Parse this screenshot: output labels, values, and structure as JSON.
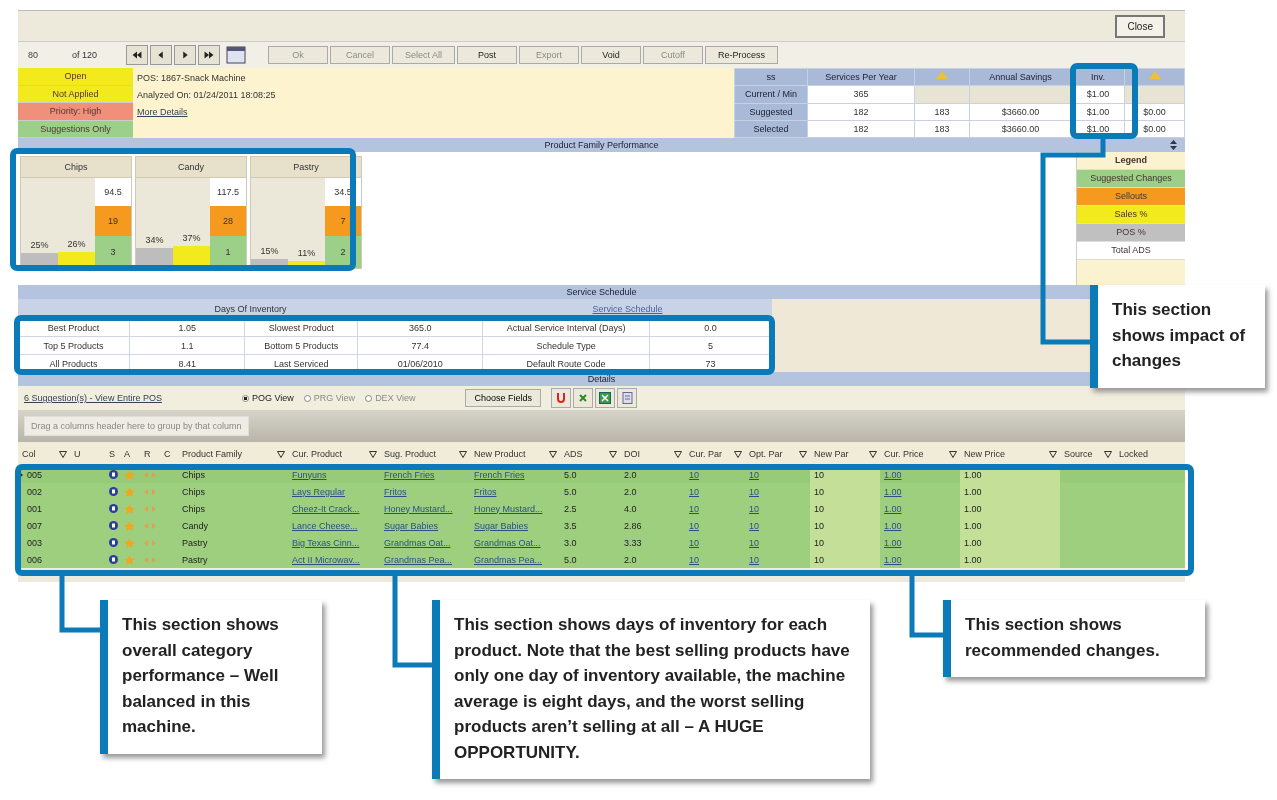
{
  "window": {
    "close_button": "Close"
  },
  "toolbar": {
    "record": "80",
    "record_count": "of 120",
    "buttons": [
      {
        "label": "Ok",
        "disabled": true
      },
      {
        "label": "Cancel",
        "disabled": true
      },
      {
        "label": "Select All",
        "disabled": true
      },
      {
        "label": "Post",
        "disabled": false
      },
      {
        "label": "Export",
        "disabled": true
      },
      {
        "label": "Void",
        "disabled": false
      },
      {
        "label": "Cutoff",
        "disabled": true
      },
      {
        "label": "Re-Process",
        "disabled": false
      }
    ]
  },
  "status_tags": [
    {
      "label": "Open",
      "color": "#f2ea1c"
    },
    {
      "label": "Not Applied",
      "color": "#f2ea1c"
    },
    {
      "label": "Priority: High",
      "color": "#f0907a"
    },
    {
      "label": "Suggestions Only",
      "color": "#9ccf88"
    }
  ],
  "info": {
    "pos": "POS: 1867-Snack Machine",
    "analyzed": "Analyzed On: 01/24/2011 18:08:25",
    "more_details": "More Details"
  },
  "summary": {
    "columns": [
      {
        "kind": "text",
        "label": "ss"
      },
      {
        "kind": "text",
        "label": "Services Per Year"
      },
      {
        "kind": "icon"
      },
      {
        "kind": "text",
        "label": "Annual Savings"
      },
      {
        "kind": "text",
        "label": "Inv."
      },
      {
        "kind": "icon"
      }
    ],
    "rows": [
      {
        "cells": [
          "Current / Min",
          "365",
          null,
          null,
          "$1.00",
          null
        ]
      },
      {
        "cells": [
          "Suggested",
          "182",
          "183",
          "$3660.00",
          "$1.00",
          "$0.00"
        ]
      },
      {
        "cells": [
          "Selected",
          "182",
          "183",
          "$3660.00",
          "$1.00",
          "$0.00"
        ]
      }
    ]
  },
  "performance": {
    "title": "Product Family Performance",
    "families": [
      {
        "name": "Chips",
        "pos_share": "25%",
        "sales_share": "26%",
        "total_ads": "94.5",
        "sellouts": "19",
        "suggested_changes": "3"
      },
      {
        "name": "Candy",
        "pos_share": "34%",
        "sales_share": "37%",
        "total_ads": "117.5",
        "sellouts": "28",
        "suggested_changes": "1"
      },
      {
        "name": "Pastry",
        "pos_share": "15%",
        "sales_share": "11%",
        "total_ads": "34.5",
        "sellouts": "7",
        "suggested_changes": "2"
      }
    ],
    "legend_title": "Legend",
    "legend": [
      {
        "label": "Suggested Changes",
        "color": "#9ccf88"
      },
      {
        "label": "Sellouts",
        "color": "#f59a1e"
      },
      {
        "label": "Sales %",
        "color": "#f2ea1c"
      },
      {
        "label": "POS %",
        "color": "#c0c0c0"
      },
      {
        "label": "Total ADS",
        "color": "#ffffff"
      }
    ]
  },
  "schedule": {
    "title": "Service Schedule",
    "groups": [
      "Days Of Inventory",
      "Service Schedule"
    ],
    "rows": [
      [
        "Best Product",
        "1.05",
        "Slowest Product",
        "365.0",
        "Actual Service Interval (Days)",
        "0.0"
      ],
      [
        "Top 5 Products",
        "1.1",
        "Bottom 5 Products",
        "77.4",
        "Schedule Type",
        "5"
      ],
      [
        "All Products",
        "8.41",
        "Last Serviced",
        "01/06/2010",
        "Default Route Code",
        "73"
      ]
    ]
  },
  "details": {
    "title": "Details",
    "link": "6 Suggestion(s) - View Entire POS",
    "views": [
      {
        "label": "POG View",
        "selected": true,
        "disabled": false
      },
      {
        "label": "PRG View",
        "selected": false,
        "disabled": true
      },
      {
        "label": "DEX View",
        "selected": false,
        "disabled": true
      }
    ],
    "choose_fields": "Choose Fields",
    "group_hint": "Drag a columns header here to group by that column",
    "columns": [
      {
        "label": "Col",
        "kind": "text",
        "filter": true
      },
      {
        "label": "U",
        "kind": "empty",
        "filter": false
      },
      {
        "label": "S",
        "kind": "status",
        "filter": false
      },
      {
        "label": "A",
        "kind": "action",
        "filter": false
      },
      {
        "label": "R",
        "kind": "reason",
        "filter": false
      },
      {
        "label": "C",
        "kind": "empty",
        "filter": false
      },
      {
        "label": "Product Family",
        "kind": "text",
        "filter": true
      },
      {
        "label": "Cur. Product",
        "kind": "link",
        "filter": true
      },
      {
        "label": "Sug. Product",
        "kind": "link",
        "filter": true
      },
      {
        "label": "New Product",
        "kind": "link",
        "filter": true
      },
      {
        "label": "ADS",
        "kind": "text",
        "filter": true
      },
      {
        "label": "DOI",
        "kind": "text",
        "filter": true
      },
      {
        "label": "Cur. Par",
        "kind": "link",
        "filter": true
      },
      {
        "label": "Opt. Par",
        "kind": "link",
        "filter": true
      },
      {
        "label": "New Par",
        "kind": "edit",
        "filter": true
      },
      {
        "label": "Cur. Price",
        "kind": "link",
        "filter": true
      },
      {
        "label": "New Price",
        "kind": "edit",
        "filter": true
      },
      {
        "label": "Source",
        "kind": "empty",
        "filter": true
      },
      {
        "label": "Locked",
        "kind": "empty",
        "filter": false
      }
    ],
    "rows": [
      {
        "current": true,
        "cells": [
          "005",
          null,
          null,
          null,
          null,
          null,
          "Chips",
          "Funyuns",
          "French Fries",
          "French Fries",
          "5.0",
          "2.0",
          "10",
          "10",
          "10",
          "1.00",
          "1.00",
          null,
          null
        ]
      },
      {
        "current": false,
        "cells": [
          "002",
          null,
          null,
          null,
          null,
          null,
          "Chips",
          "Lays Regular",
          "Fritos",
          "Fritos",
          "5.0",
          "2.0",
          "10",
          "10",
          "10",
          "1.00",
          "1.00",
          null,
          null
        ]
      },
      {
        "current": false,
        "cells": [
          "001",
          null,
          null,
          null,
          null,
          null,
          "Chips",
          "Cheez-It Crack...",
          "Honey Mustard...",
          "Honey Mustard...",
          "2.5",
          "4.0",
          "10",
          "10",
          "10",
          "1.00",
          "1.00",
          null,
          null
        ]
      },
      {
        "current": false,
        "cells": [
          "007",
          null,
          null,
          null,
          null,
          null,
          "Candy",
          "Lance Cheese...",
          "Sugar Babies",
          "Sugar Babies",
          "3.5",
          "2.86",
          "10",
          "10",
          "10",
          "1.00",
          "1.00",
          null,
          null
        ]
      },
      {
        "current": false,
        "cells": [
          "003",
          null,
          null,
          null,
          null,
          null,
          "Pastry",
          "Big Texas Cinn...",
          "Grandmas Oat...",
          "Grandmas Oat...",
          "3.0",
          "3.33",
          "10",
          "10",
          "10",
          "1.00",
          "1.00",
          null,
          null
        ]
      },
      {
        "current": false,
        "cells": [
          "006",
          null,
          null,
          null,
          null,
          null,
          "Pastry",
          "Act II Microwav...",
          "Grandmas Pea...",
          "Grandmas Pea...",
          "5.0",
          "2.0",
          "10",
          "10",
          "10",
          "1.00",
          "1.00",
          null,
          null
        ]
      }
    ]
  },
  "callouts": [
    "This section shows impact of changes",
    "This section shows overall category performance – Well balanced in this machine.",
    "This section shows days of inventory for each product. Note that the best selling products have only one day of inventory available, the machine average is eight days, and the worst selling products aren’t selling at all – A HUGE OPPORTUNITY.",
    "This section shows recommended changes."
  ]
}
